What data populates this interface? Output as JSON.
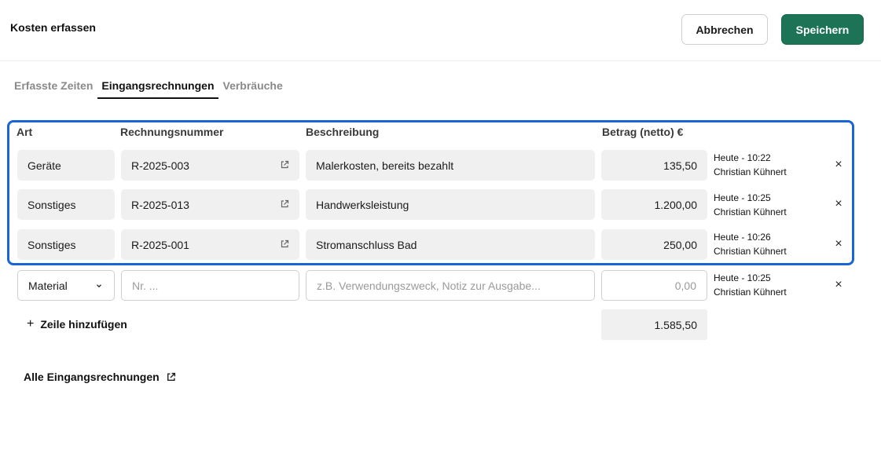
{
  "header": {
    "title": "Kosten erfassen",
    "cancel_label": "Abbrechen",
    "save_label": "Speichern"
  },
  "tabs": [
    {
      "label": "Erfasste Zeiten",
      "active": false
    },
    {
      "label": "Eingangsrechnungen",
      "active": true
    },
    {
      "label": "Verbräuche",
      "active": false
    }
  ],
  "table": {
    "columns": [
      "Art",
      "Rechnungsnummer",
      "Beschreibung",
      "Betrag (netto) €"
    ],
    "rows": [
      {
        "art": "Geräte",
        "nummer": "R-2025-003",
        "beschreibung": "Malerkosten, bereits bezahlt",
        "betrag": "135,50",
        "time": "Heute - 10:22",
        "user": "Christian Kühnert"
      },
      {
        "art": "Sonstiges",
        "nummer": "R-2025-013",
        "beschreibung": "Handwerksleistung",
        "betrag": "1.200,00",
        "time": "Heute - 10:25",
        "user": "Christian Kühnert"
      },
      {
        "art": "Sonstiges",
        "nummer": "R-2025-001",
        "beschreibung": "Stromanschluss Bad",
        "betrag": "250,00",
        "time": "Heute - 10:26",
        "user": "Christian Kühnert"
      }
    ],
    "new_row": {
      "art_selected": "Material",
      "nummer_placeholder": "Nr. ...",
      "beschreibung_placeholder": "z.B. Verwendungszweck, Notiz zur Ausgabe...",
      "betrag_placeholder": "0,00",
      "time": "Heute - 10:25",
      "user": "Christian Kühnert"
    },
    "total": "1.585,50"
  },
  "actions": {
    "add_row_label": "Zeile hinzufügen",
    "all_invoices_label": "Alle Eingangsrechnungen"
  },
  "icons": {
    "external_link": "external-link-icon",
    "close": "close-icon",
    "chevron_down": "chevron-down-icon",
    "plus": "plus-icon"
  },
  "colors": {
    "primary": "#1d7355",
    "highlight": "#1a64d6",
    "cell_bg": "#f1f0f1"
  }
}
